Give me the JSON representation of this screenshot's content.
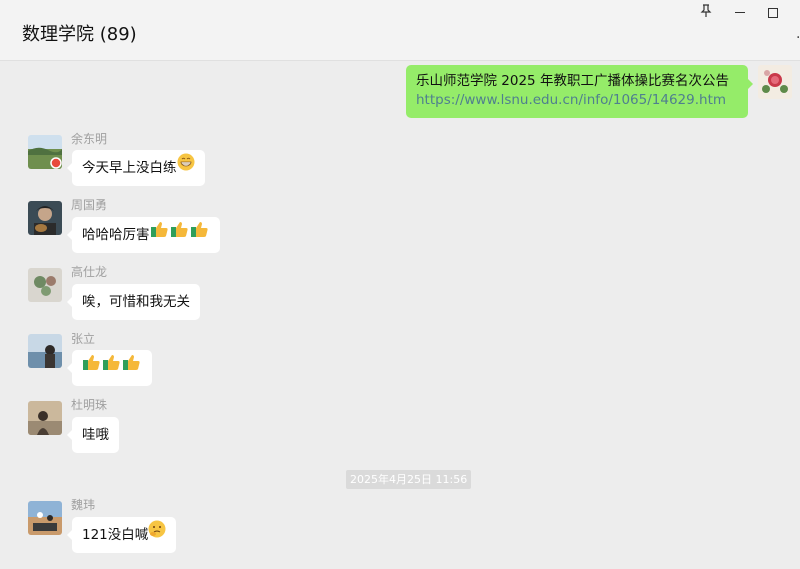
{
  "header": {
    "title": "数理学院 (89)"
  },
  "window_controls": {
    "pin_icon": "pin-icon",
    "minimize_icon": "minimize-icon",
    "maximize_icon": "maximize-icon"
  },
  "my_message": {
    "line1": "乐山师范学院 2025 年教职工广播体操比赛名次公告",
    "link": "https://www.lsnu.edu.cn/info/1065/14629.htm"
  },
  "messages": [
    {
      "sender": "余东明",
      "text": "今天早上没白练",
      "emoji": "grinning-face"
    },
    {
      "sender": "周国勇",
      "text": "哈哈哈厉害",
      "emoji": "thumbs-up x3"
    },
    {
      "sender": "高仕龙",
      "text": "唉，可惜和我无关"
    },
    {
      "sender": "张立",
      "text": "",
      "emoji": "thumbs-up x3"
    },
    {
      "sender": "杜明珠",
      "text": "哇哦"
    },
    {
      "sender": "魏玮",
      "text": "121没白喊",
      "emoji": "thinking-face"
    }
  ],
  "timestamp": "2025年4月25日 11:56"
}
